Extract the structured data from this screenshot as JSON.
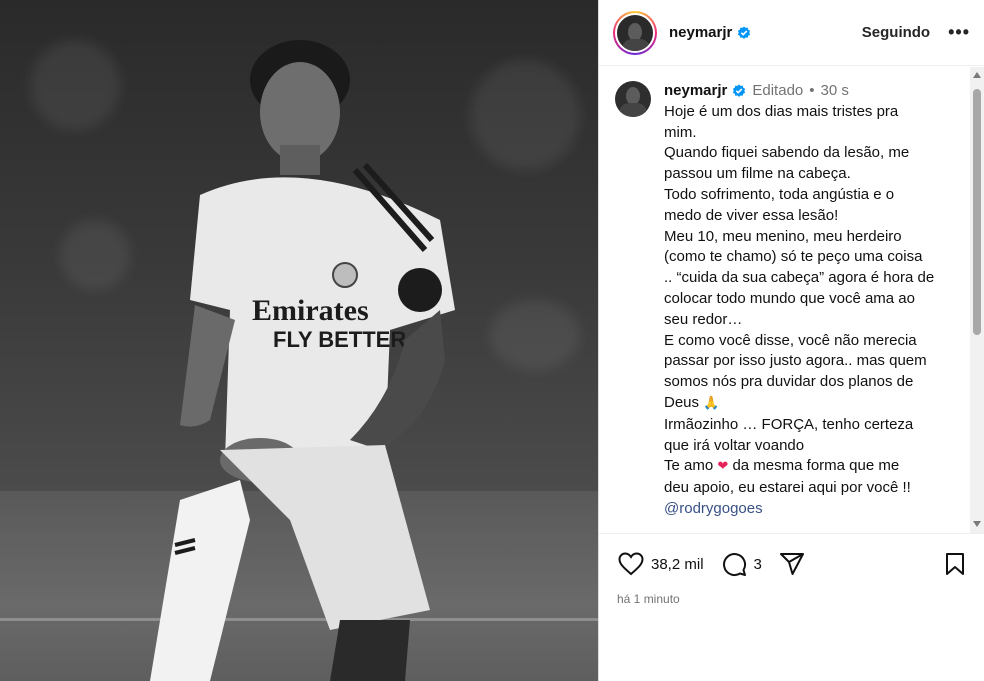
{
  "header": {
    "username": "neymarjr",
    "following_label": "Seguindo",
    "more_label": "•••"
  },
  "caption": {
    "username": "neymarjr",
    "edited_label": "Editado",
    "separator": "•",
    "time": "30 s",
    "lines": [
      "Hoje é um dos dias mais tristes pra",
      "mim.",
      "Quando fiquei sabendo da lesão, me",
      "passou um filme na cabeça.",
      "Todo sofrimento, toda angústia e o",
      "medo de viver essa lesão!",
      "Meu 10, meu menino, meu herdeiro",
      "(como te chamo) só te peço uma coisa",
      ".. “cuida da sua cabeça” agora é hora de",
      "colocar todo mundo que você ama ao",
      "seu redor…",
      "E como você disse, você não merecia",
      "passar por isso justo agora.. mas quem",
      "somos nós pra duvidar dos planos de"
    ],
    "line_deus": "Deus",
    "emoji_deus": "🙏",
    "line_irmao": "Irmãozinho … FORÇA, tenho certeza",
    "line_voltar": "que irá voltar voando",
    "line_teamo_pre": "Te amo",
    "emoji_heart": "❤",
    "line_teamo_post": "da mesma forma que me",
    "line_apoio": "deu apoio, eu estarei aqui por você !!",
    "mention": "@rodrygogoes"
  },
  "actions": {
    "likes": "38,2 mil",
    "comments": "3",
    "time_ago": "há 1 minuto"
  },
  "colors": {
    "verified": "#0095f6",
    "mention": "#385185",
    "heart": "#e8235a"
  },
  "icons": {
    "verified": "verified-badge-icon",
    "like": "heart-icon",
    "comment": "comment-bubble-icon",
    "share": "paper-plane-icon",
    "save": "bookmark-icon"
  }
}
